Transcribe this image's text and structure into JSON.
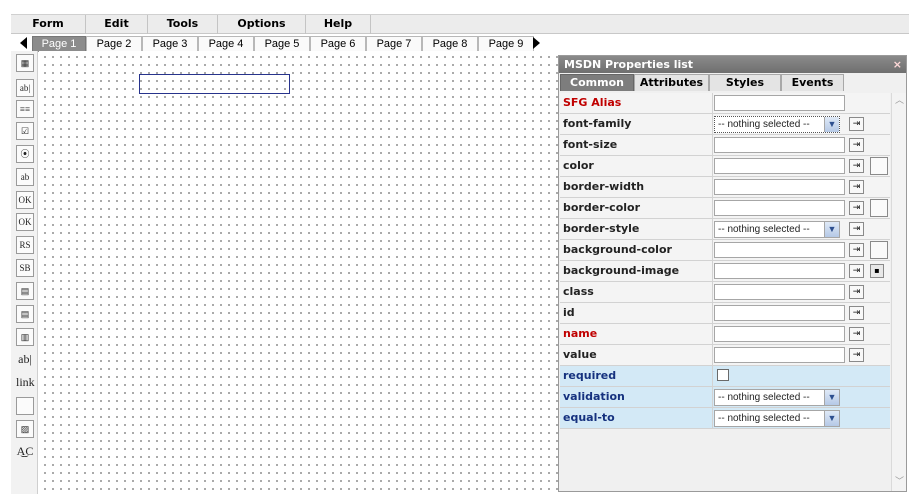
{
  "menu": [
    "Form",
    "Edit",
    "Tools",
    "Options",
    "Help"
  ],
  "pages": {
    "tabs": [
      "Page 1",
      "Page 2",
      "Page 3",
      "Page 4",
      "Page 5",
      "Page 6",
      "Page 7",
      "Page 8",
      "Page 9"
    ],
    "active": "Page 1"
  },
  "toolbox": {
    "tools": [
      {
        "name": "chart-tool-icon",
        "glyph": "▦"
      },
      {
        "name": "text-field-tool-icon",
        "glyph": "ab|"
      },
      {
        "name": "text-area-tool-icon",
        "glyph": "≡≡"
      },
      {
        "name": "checkbox-tool-icon",
        "glyph": "☑"
      },
      {
        "name": "radio-tool-icon",
        "glyph": "⦿"
      },
      {
        "name": "edit-field-tool-icon",
        "glyph": "ab"
      },
      {
        "name": "button1-tool-icon",
        "glyph": "OK"
      },
      {
        "name": "button2-tool-icon",
        "glyph": "OK"
      },
      {
        "name": "reset-button-tool-icon",
        "glyph": "RS"
      },
      {
        "name": "submit-button-tool-icon",
        "glyph": "SB"
      },
      {
        "name": "list-tool-icon",
        "glyph": "▤"
      },
      {
        "name": "select-tool-icon",
        "glyph": "▤"
      },
      {
        "name": "multiselect-tool-icon",
        "glyph": "▥"
      },
      {
        "name": "label-tool-icon",
        "glyph": "ab|"
      },
      {
        "name": "link-tool-icon",
        "glyph": "link"
      },
      {
        "name": "frame-tool-icon",
        "glyph": ""
      },
      {
        "name": "image-tool-icon",
        "glyph": "▨"
      },
      {
        "name": "spellcheck-tool-icon",
        "glyph": "A͜C"
      }
    ]
  },
  "panel": {
    "title": "MSDN Properties list",
    "close": "×",
    "tabs": [
      "Common",
      "Attributes",
      "Styles",
      "Events"
    ],
    "active_tab": "Common",
    "rows": [
      {
        "label": "SFG Alias",
        "style": "red",
        "control": "input",
        "value": ""
      },
      {
        "label": "font-family",
        "style": "normal",
        "control": "select",
        "value": "-- nothing selected --",
        "focused": true,
        "action": true
      },
      {
        "label": "font-size",
        "style": "normal",
        "control": "input",
        "value": "",
        "action": true
      },
      {
        "label": "color",
        "style": "normal",
        "control": "input",
        "value": "",
        "action": true,
        "swatch": true
      },
      {
        "label": "border-width",
        "style": "normal",
        "control": "input",
        "value": "",
        "action": true
      },
      {
        "label": "border-color",
        "style": "normal",
        "control": "input",
        "value": "",
        "action": true,
        "swatch": true
      },
      {
        "label": "border-style",
        "style": "normal",
        "control": "select",
        "value": "-- nothing selected --",
        "action": true
      },
      {
        "label": "background-color",
        "style": "normal",
        "control": "input",
        "value": "",
        "action": true,
        "swatch": true
      },
      {
        "label": "background-image",
        "style": "normal",
        "control": "input",
        "value": "",
        "action": true,
        "image": true
      },
      {
        "label": "class",
        "style": "normal",
        "control": "input",
        "value": "",
        "action": true
      },
      {
        "label": "id",
        "style": "normal",
        "control": "input",
        "value": "",
        "action": true
      },
      {
        "label": "name",
        "style": "red",
        "control": "input",
        "value": "",
        "action": true
      },
      {
        "label": "value",
        "style": "normal",
        "control": "input",
        "value": "",
        "action": true
      },
      {
        "label": "required",
        "style": "blue",
        "control": "checkbox",
        "value": "",
        "row_bg": "blue"
      },
      {
        "label": "validation",
        "style": "blue",
        "control": "select",
        "value": "-- nothing selected --",
        "row_bg": "blue"
      },
      {
        "label": "equal-to",
        "style": "blue",
        "control": "select",
        "value": "-- nothing selected --",
        "row_bg": "blue"
      }
    ]
  }
}
